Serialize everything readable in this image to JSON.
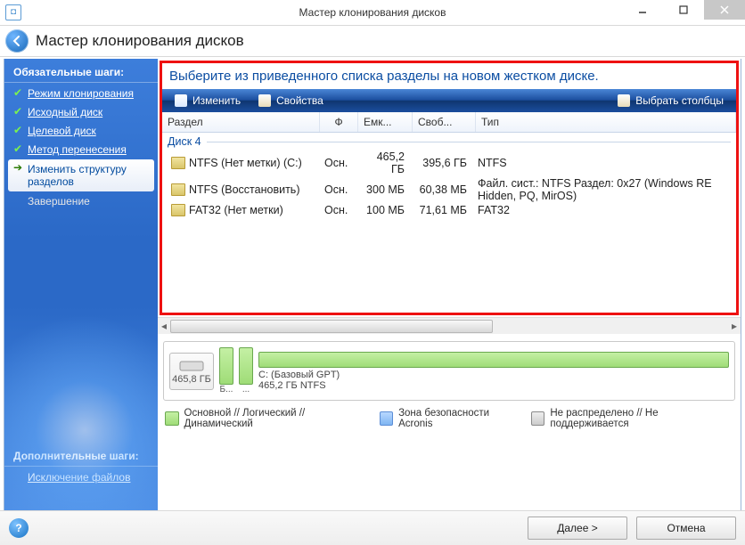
{
  "window": {
    "title": "Мастер клонирования дисков",
    "page_title": "Мастер клонирования дисков"
  },
  "sidebar": {
    "required_title": "Обязательные шаги:",
    "additional_title": "Дополнительные шаги:",
    "steps": [
      {
        "label": "Режим клонирования",
        "state": "done"
      },
      {
        "label": "Исходный диск",
        "state": "done"
      },
      {
        "label": "Целевой диск",
        "state": "done"
      },
      {
        "label": "Метод перенесения",
        "state": "done"
      },
      {
        "label": "Изменить структуру разделов",
        "state": "active"
      },
      {
        "label": "Завершение",
        "state": "pending"
      }
    ],
    "additional": [
      {
        "label": "Исключение файлов"
      }
    ]
  },
  "main": {
    "instruction": "Выберите из приведенного списка разделы на новом жестком диске.",
    "toolbar": {
      "edit": "Изменить",
      "props": "Свойства",
      "choose_cols": "Выбрать столбцы"
    },
    "columns": {
      "partition": "Раздел",
      "flag": "Ф",
      "capacity": "Емк...",
      "free": "Своб...",
      "type": "Тип"
    },
    "disk_group_label": "Диск 4",
    "rows": [
      {
        "part": "NTFS (Нет метки) (C:)",
        "flag": "Осн.",
        "cap": "465,2 ГБ",
        "free": "395,6 ГБ",
        "type": "NTFS"
      },
      {
        "part": "NTFS (Восстановить)",
        "flag": "Осн.",
        "cap": "300 МБ",
        "free": "60,38 МБ",
        "type": "Файл. сист.: NTFS Раздел: 0x27 (Windows RE Hidden, PQ, MirOS)"
      },
      {
        "part": "FAT32 (Нет метки)",
        "flag": "Осн.",
        "cap": "100 МБ",
        "free": "71,61 МБ",
        "type": "FAT32"
      }
    ],
    "diskmap": {
      "total": "465,8 ГБ",
      "mini1": "Б...",
      "mini2": "...",
      "big_label_line1": "C: (Базовый GPT)",
      "big_label_line2": "465,2 ГБ   NTFS"
    },
    "legend": {
      "primary": "Основной // Логический // Динамический",
      "acronis": "Зона безопасности Acronis",
      "unalloc": "Не распределено // Не поддерживается"
    }
  },
  "footer": {
    "next": "Далее >",
    "cancel": "Отмена"
  }
}
